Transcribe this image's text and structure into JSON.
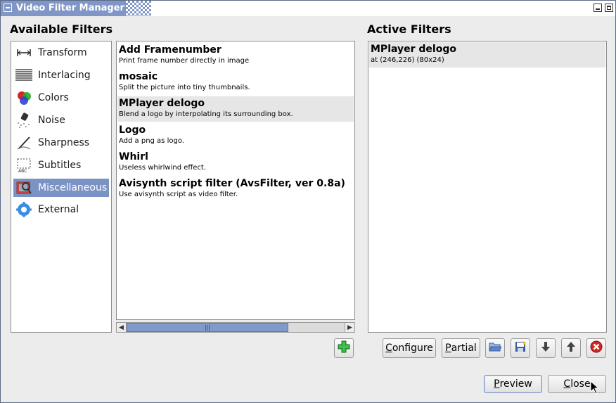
{
  "window": {
    "title": "Video Filter Manager"
  },
  "available": {
    "heading": "Available Filters",
    "categories": [
      {
        "label": "Transform",
        "icon": "transform-icon"
      },
      {
        "label": "Interlacing",
        "icon": "interlacing-icon"
      },
      {
        "label": "Colors",
        "icon": "colors-icon"
      },
      {
        "label": "Noise",
        "icon": "noise-icon"
      },
      {
        "label": "Sharpness",
        "icon": "sharpness-icon"
      },
      {
        "label": "Subtitles",
        "icon": "subtitles-icon"
      },
      {
        "label": "Miscellaneous",
        "icon": "miscellaneous-icon",
        "selected": true
      },
      {
        "label": "External",
        "icon": "external-icon"
      }
    ],
    "filters": [
      {
        "name": "Add Framenumber",
        "desc": "Print frame number directly in image"
      },
      {
        "name": "mosaic",
        "desc": "Split the picture into tiny thumbnails."
      },
      {
        "name": "MPlayer delogo",
        "desc": "Blend a logo by interpolating its surrounding box.",
        "selected": true
      },
      {
        "name": "Logo",
        "desc": "Add a png as logo."
      },
      {
        "name": "Whirl",
        "desc": "Useless whirlwind effect."
      },
      {
        "name": "Avisynth script filter (AvsFilter, ver 0.8a)",
        "desc": "Use avisynth script as video filter."
      }
    ]
  },
  "active": {
    "heading": "Active Filters",
    "items": [
      {
        "name": "MPlayer delogo",
        "desc": "at (246,226) (80x24)"
      }
    ]
  },
  "buttons": {
    "configure_pre": "",
    "configure_mnemonic": "C",
    "configure_post": "onfigure",
    "partial_pre": "",
    "partial_mnemonic": "P",
    "partial_post": "artial",
    "preview_pre": "",
    "preview_mnemonic": "P",
    "preview_post": "review",
    "close_pre": "",
    "close_mnemonic": "C",
    "close_post": "lose"
  },
  "colors": {
    "title_bar": "#7f96c6",
    "selection": "#7b93c4",
    "window_bg": "#ececec"
  }
}
